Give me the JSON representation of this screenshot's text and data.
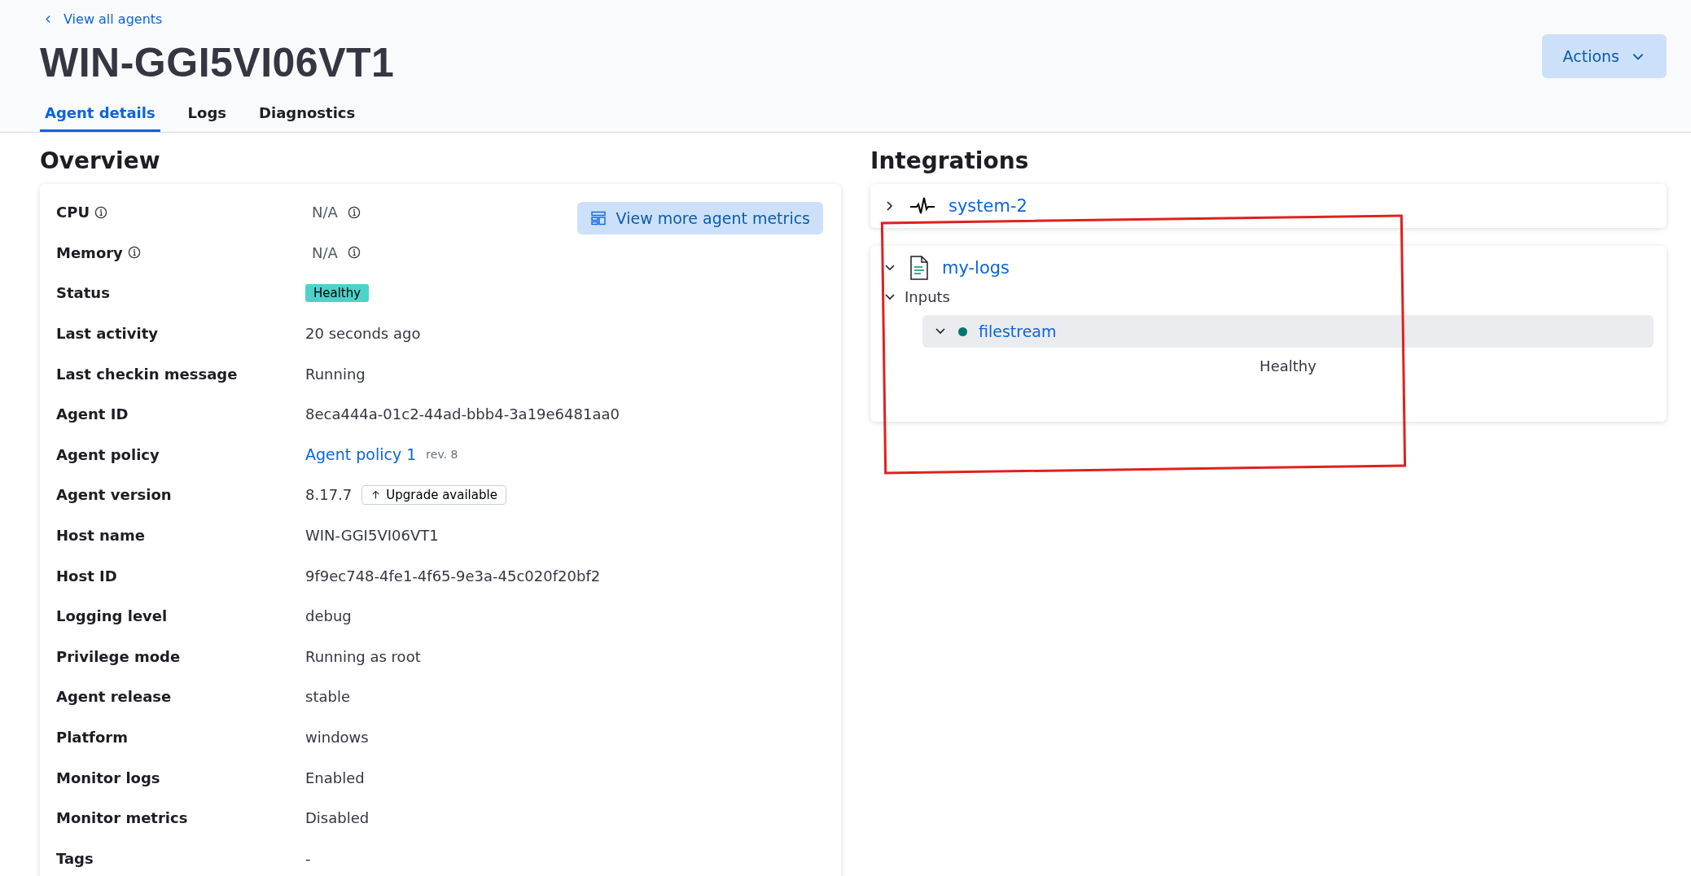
{
  "back_link": "View all agents",
  "title": "WIN-GGI5VI06VT1",
  "actions_button": "Actions",
  "tabs": [
    {
      "label": "Agent details",
      "selected": true
    },
    {
      "label": "Logs",
      "selected": false
    },
    {
      "label": "Diagnostics",
      "selected": false
    }
  ],
  "overview": {
    "heading": "Overview",
    "metrics_button": "View more agent metrics",
    "rows": [
      {
        "label": "CPU",
        "info": true,
        "kind": "na",
        "value": "N/A"
      },
      {
        "label": "Memory",
        "info": true,
        "kind": "na",
        "value": "N/A"
      },
      {
        "label": "Status",
        "info": false,
        "kind": "badge",
        "value": "Healthy"
      },
      {
        "label": "Last activity",
        "info": false,
        "kind": "text",
        "value": "20 seconds ago"
      },
      {
        "label": "Last checkin message",
        "info": false,
        "kind": "text",
        "value": "Running"
      },
      {
        "label": "Agent ID",
        "info": false,
        "kind": "text",
        "value": "8eca444a-01c2-44ad-bbb4-3a19e6481aa0"
      },
      {
        "label": "Agent policy",
        "info": false,
        "kind": "link",
        "value": "Agent policy 1",
        "note": "rev. 8"
      },
      {
        "label": "Agent version",
        "info": false,
        "kind": "version",
        "value": "8.17.7",
        "button": "Upgrade available"
      },
      {
        "label": "Host name",
        "info": false,
        "kind": "text",
        "value": "WIN-GGI5VI06VT1"
      },
      {
        "label": "Host ID",
        "info": false,
        "kind": "text",
        "value": "9f9ec748-4fe1-4f65-9e3a-45c020f20bf2"
      },
      {
        "label": "Logging level",
        "info": false,
        "kind": "text",
        "value": "debug"
      },
      {
        "label": "Privilege mode",
        "info": false,
        "kind": "text",
        "value": "Running as root"
      },
      {
        "label": "Agent release",
        "info": false,
        "kind": "text",
        "value": "stable"
      },
      {
        "label": "Platform",
        "info": false,
        "kind": "text",
        "value": "windows"
      },
      {
        "label": "Monitor logs",
        "info": false,
        "kind": "text",
        "value": "Enabled"
      },
      {
        "label": "Monitor metrics",
        "info": false,
        "kind": "text",
        "value": "Disabled"
      },
      {
        "label": "Tags",
        "info": false,
        "kind": "text",
        "value": "-"
      }
    ]
  },
  "integrations": {
    "heading": "Integrations",
    "items": [
      {
        "name": "system-2",
        "kind": "metrics",
        "expanded": false
      },
      {
        "name": "my-logs",
        "kind": "logs",
        "expanded": true,
        "inputs_label": "Inputs",
        "inputs_expanded": true,
        "inputs": [
          {
            "name": "filestream",
            "color": "#00766e",
            "expanded": true,
            "status": "Healthy"
          }
        ]
      }
    ]
  }
}
